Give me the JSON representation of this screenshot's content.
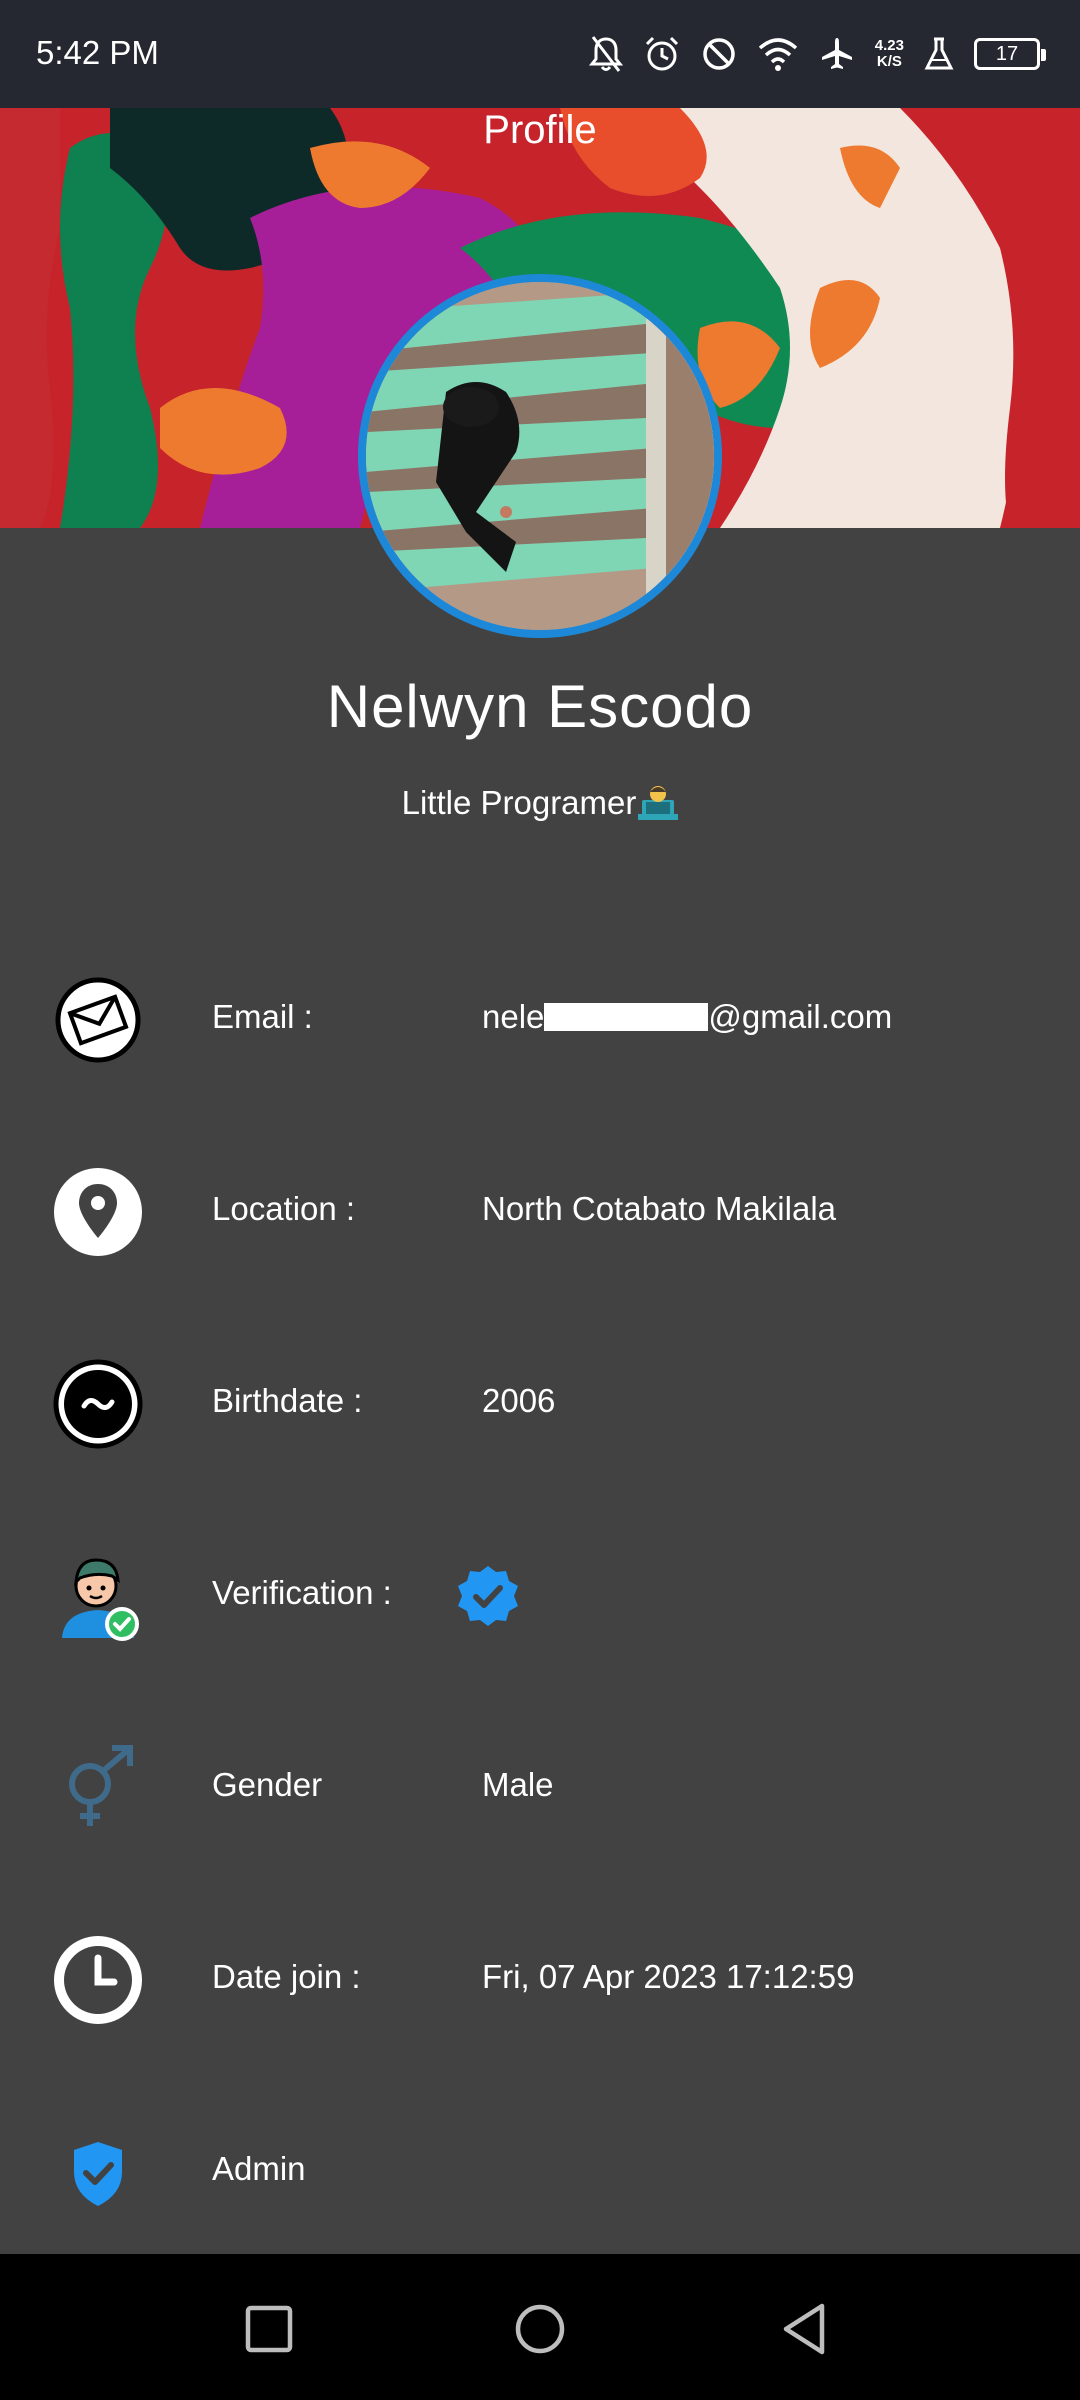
{
  "status_bar": {
    "time": "5:42 PM",
    "net_speed_value": "4.23",
    "net_speed_unit": "K/S",
    "battery": "17",
    "icons": [
      "mute-bell-icon",
      "alarm-icon",
      "do-not-disturb-icon",
      "wifi-icon",
      "airplane-icon",
      "lab-flask-icon",
      "battery-icon"
    ]
  },
  "header": {
    "title": "Profile"
  },
  "profile": {
    "name": "Nelwyn Escodo",
    "bio": "Little Programer"
  },
  "rows": [
    {
      "label": "Email :",
      "value_prefix": "nele",
      "value_suffix": "@gmail.com",
      "icon": "envelope-icon"
    },
    {
      "label": "Location :",
      "value": "North Cotabato Makilala",
      "icon": "location-pin-icon"
    },
    {
      "label": "Birthdate :",
      "value": "2006",
      "icon": "wave-badge-icon"
    },
    {
      "label": "Verification :",
      "icon": "verified-user-icon",
      "value_icon": "verified-badge-icon"
    },
    {
      "label": "Gender",
      "value": "Male",
      "icon": "gender-icon"
    },
    {
      "label": "Date join :",
      "value": "Fri, 07 Apr 2023 17:12:59",
      "icon": "clock-icon"
    },
    {
      "label": "Admin",
      "icon": "admin-shield-icon"
    }
  ],
  "colors": {
    "background": "#424242",
    "status_bar": "#252830",
    "accent_blue": "#1e88d8",
    "nav_bar": "#000000"
  }
}
